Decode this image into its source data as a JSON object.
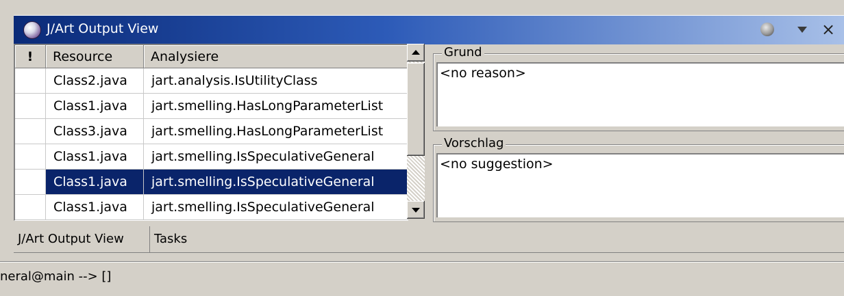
{
  "window": {
    "title": "J/Art Output View",
    "icons": [
      "app-globe-icon",
      "view-globe-icon",
      "view-menu-icon",
      "close-icon"
    ],
    "close_glyph": "×"
  },
  "table": {
    "columns": [
      "!",
      "Resource",
      "Analysiere"
    ],
    "rows": [
      {
        "resource": "Class2.java",
        "analyzer": "jart.analysis.IsUtilityClass",
        "selected": false
      },
      {
        "resource": "Class1.java",
        "analyzer": "jart.smelling.HasLongParameterList",
        "selected": false
      },
      {
        "resource": "Class3.java",
        "analyzer": "jart.smelling.HasLongParameterList",
        "selected": false
      },
      {
        "resource": "Class1.java",
        "analyzer": "jart.smelling.IsSpeculativeGeneral",
        "selected": false
      },
      {
        "resource": "Class1.java",
        "analyzer": "jart.smelling.IsSpeculativeGeneral",
        "selected": true
      },
      {
        "resource": "Class1.java",
        "analyzer": "jart.smelling.IsSpeculativeGeneral",
        "selected": false
      }
    ]
  },
  "details": {
    "reason_label": "Grund",
    "reason_value": "<no reason>",
    "suggestion_label": "Vorschlag",
    "suggestion_value": "<no suggestion>"
  },
  "tabs": [
    {
      "label": "J/Art Output View",
      "active": true
    },
    {
      "label": "Tasks",
      "active": false
    }
  ],
  "status": {
    "text": "neral@main --> []"
  },
  "colors": {
    "selection": "#0a246a",
    "titlebar_start": "#0a2a78",
    "titlebar_end": "#a8c0e8",
    "chrome": "#d4d0c8"
  }
}
